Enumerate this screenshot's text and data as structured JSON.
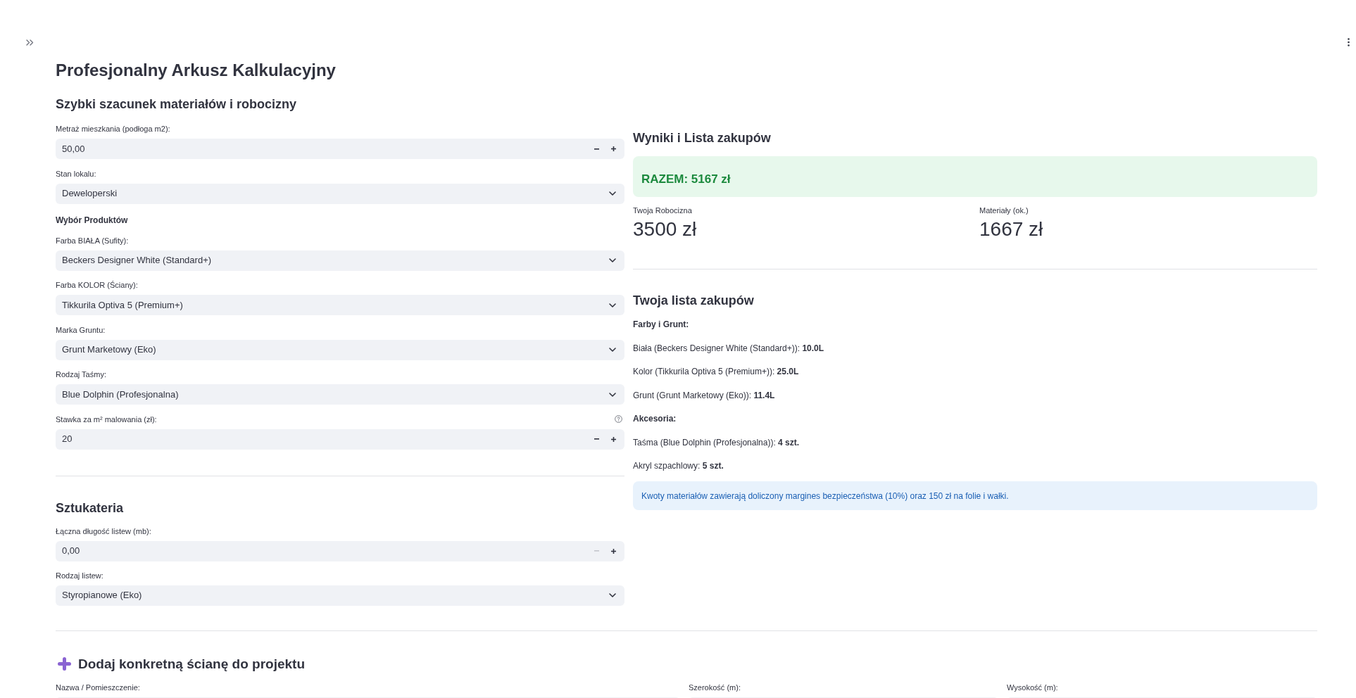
{
  "title": "Profesjonalny Arkusz Kalkulacyjny",
  "estimate": {
    "heading": "Szybki szacunek materiałów i robocizny",
    "fields": [
      {
        "kind": "number",
        "label": "Metraż mieszkania (podłoga m2):",
        "value": "50,00",
        "minus_disabled": false,
        "help": false
      },
      {
        "kind": "select",
        "label": "Stan lokalu:",
        "value": "Deweloperski"
      },
      {
        "kind": "subheading",
        "text": "Wybór Produktów"
      },
      {
        "kind": "select",
        "label": "Farba BIAŁA (Sufity):",
        "value": "Beckers Designer White (Standard+)"
      },
      {
        "kind": "select",
        "label": "Farba KOLOR (Ściany):",
        "value": "Tikkurila Optiva 5 (Premium+)"
      },
      {
        "kind": "select",
        "label": "Marka Gruntu:",
        "value": "Grunt Marketowy (Eko)"
      },
      {
        "kind": "select",
        "label": "Rodzaj Taśmy:",
        "value": "Blue Dolphin (Profesjonalna)"
      },
      {
        "kind": "number",
        "label": "Stawka za m² malowania (zł):",
        "value": "20",
        "minus_disabled": false,
        "help": true
      }
    ]
  },
  "moldings": {
    "heading": "Sztukateria",
    "fields": [
      {
        "kind": "number",
        "label": "Łączna długość listew (mb):",
        "value": "0,00",
        "minus_disabled": true,
        "help": false
      },
      {
        "kind": "select",
        "label": "Rodzaj listew:",
        "value": "Styropianowe (Eko)"
      }
    ]
  },
  "results": {
    "heading": "Wyniki i Lista zakupów",
    "total": "RAZEM: 5167 zł",
    "metrics": [
      {
        "label": "Twoja Robocizna",
        "value": "3500 zł"
      },
      {
        "label": "Materiały (ok.)",
        "value": "1667 zł"
      }
    ]
  },
  "shopping_list": {
    "heading": "Twoja lista zakupów",
    "groups": [
      {
        "heading": "Farby i Grunt:",
        "items": [
          "Biała (Beckers Designer White (Standard+)): **10.0L**",
          "Kolor (Tikkurila Optiva 5 (Premium+)): **25.0L**",
          "Grunt (Grunt Marketowy (Eko)): **11.4L**"
        ]
      },
      {
        "heading": "Akcesoria:",
        "items": [
          "Taśma (Blue Dolphin (Profesjonalna)): **4 szt.**",
          "Akryl szpachlowy: **5 szt.**"
        ]
      }
    ],
    "note": "Kwoty materiałów zawierają doliczony margines bezpieczeństwa (10%) oraz 150 zł na folie i wałki."
  },
  "add_wall": {
    "heading": "Dodaj konkretną ścianę do projektu",
    "fields": [
      {
        "label": "Nazwa / Pomieszczenie:"
      },
      {
        "label": "Szerokość (m):"
      },
      {
        "label": "Wysokość (m):"
      }
    ]
  }
}
